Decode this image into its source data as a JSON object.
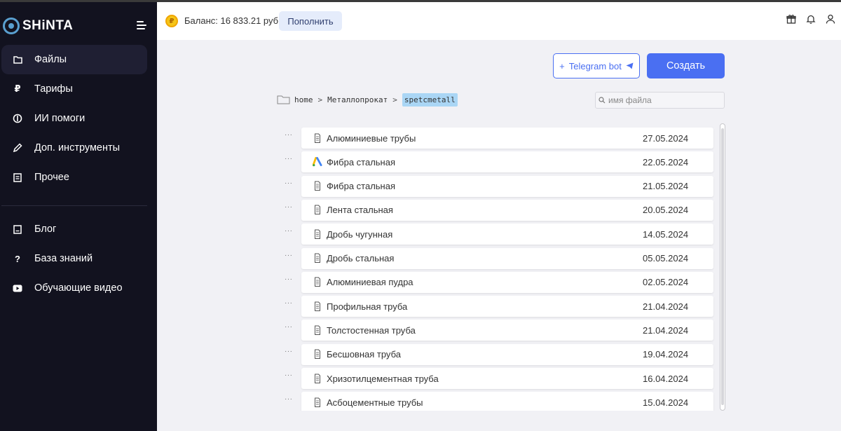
{
  "app": {
    "logo_text": "SHiNTA"
  },
  "sidebar": {
    "items": [
      {
        "label": "Файлы",
        "icon": "folder-icon",
        "active": true
      },
      {
        "label": "Тарифы",
        "icon": "ruble-icon",
        "active": false
      },
      {
        "label": "ИИ помоги",
        "icon": "ai-icon",
        "active": false
      },
      {
        "label": "Доп. инструменты",
        "icon": "pencil-icon",
        "active": false
      },
      {
        "label": "Прочее",
        "icon": "list-icon",
        "active": false
      }
    ],
    "secondary_items": [
      {
        "label": "Блог",
        "icon": "blog-icon"
      },
      {
        "label": "База знаний",
        "icon": "question-icon"
      },
      {
        "label": "Обучающие видео",
        "icon": "video-icon"
      }
    ]
  },
  "header": {
    "balance": "Баланс: 16 833.21 руб.",
    "topup_label": "Пополнить"
  },
  "actions": {
    "telegram_label": "Telegram bot",
    "create_label": "Создать"
  },
  "breadcrumb": {
    "items": [
      "home",
      "Металлопрокат",
      "spetcmetall"
    ],
    "separator": ">"
  },
  "search": {
    "placeholder": "имя файла",
    "value": ""
  },
  "files": [
    {
      "name": "Алюминиевые трубы",
      "date": "27.05.2024",
      "icon": "file-icon"
    },
    {
      "name": "Фибра стальная",
      "date": "22.05.2024",
      "icon": "google-ads-icon"
    },
    {
      "name": "Фибра стальная",
      "date": "21.05.2024",
      "icon": "file-icon"
    },
    {
      "name": "Лента стальная",
      "date": "20.05.2024",
      "icon": "file-icon"
    },
    {
      "name": "Дробь чугунная",
      "date": "14.05.2024",
      "icon": "file-icon"
    },
    {
      "name": "Дробь стальная",
      "date": "05.05.2024",
      "icon": "file-icon"
    },
    {
      "name": "Алюминиевая пудра",
      "date": "02.05.2024",
      "icon": "file-icon"
    },
    {
      "name": "Профильная труба",
      "date": "21.04.2024",
      "icon": "file-icon"
    },
    {
      "name": "Толстостенная труба",
      "date": "21.04.2024",
      "icon": "file-icon"
    },
    {
      "name": "Бесшовная труба",
      "date": "19.04.2024",
      "icon": "file-icon"
    },
    {
      "name": "Хризотилцементная труба",
      "date": "16.04.2024",
      "icon": "file-icon"
    },
    {
      "name": "Асбоцементные трубы",
      "date": "15.04.2024",
      "icon": "file-icon"
    }
  ],
  "colors": {
    "sidebar_bg": "#12121f",
    "accent": "#4a6ff2",
    "breadcrumb_highlight": "#aad6f5"
  }
}
